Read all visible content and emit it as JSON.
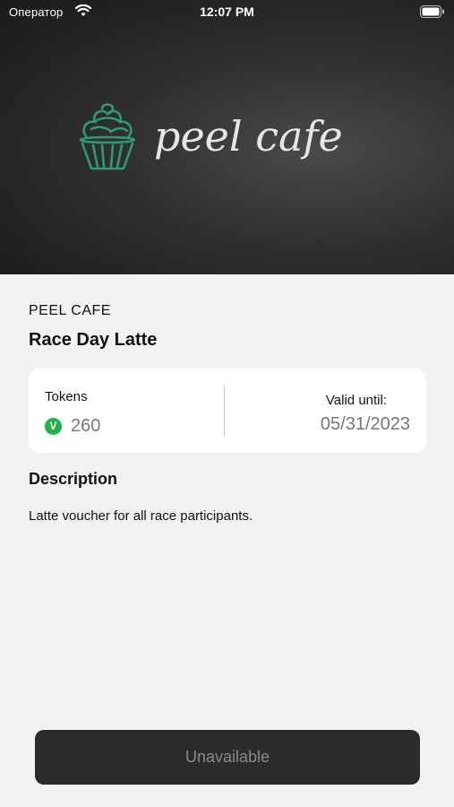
{
  "status_bar": {
    "carrier": "Оператор",
    "time": "12:07 PM"
  },
  "hero": {
    "logo_text": "peel cafe",
    "accent_color": "#2f9a73"
  },
  "offer": {
    "merchant": "PEEL CAFE",
    "title": "Race Day Latte"
  },
  "details": {
    "tokens_label": "Tokens",
    "token_icon_letter": "V",
    "tokens_value": "260",
    "valid_label": "Valid until:",
    "valid_value": "05/31/2023"
  },
  "description": {
    "heading": "Description",
    "text": "Latte voucher for all race participants."
  },
  "action": {
    "label": "Unavailable"
  }
}
